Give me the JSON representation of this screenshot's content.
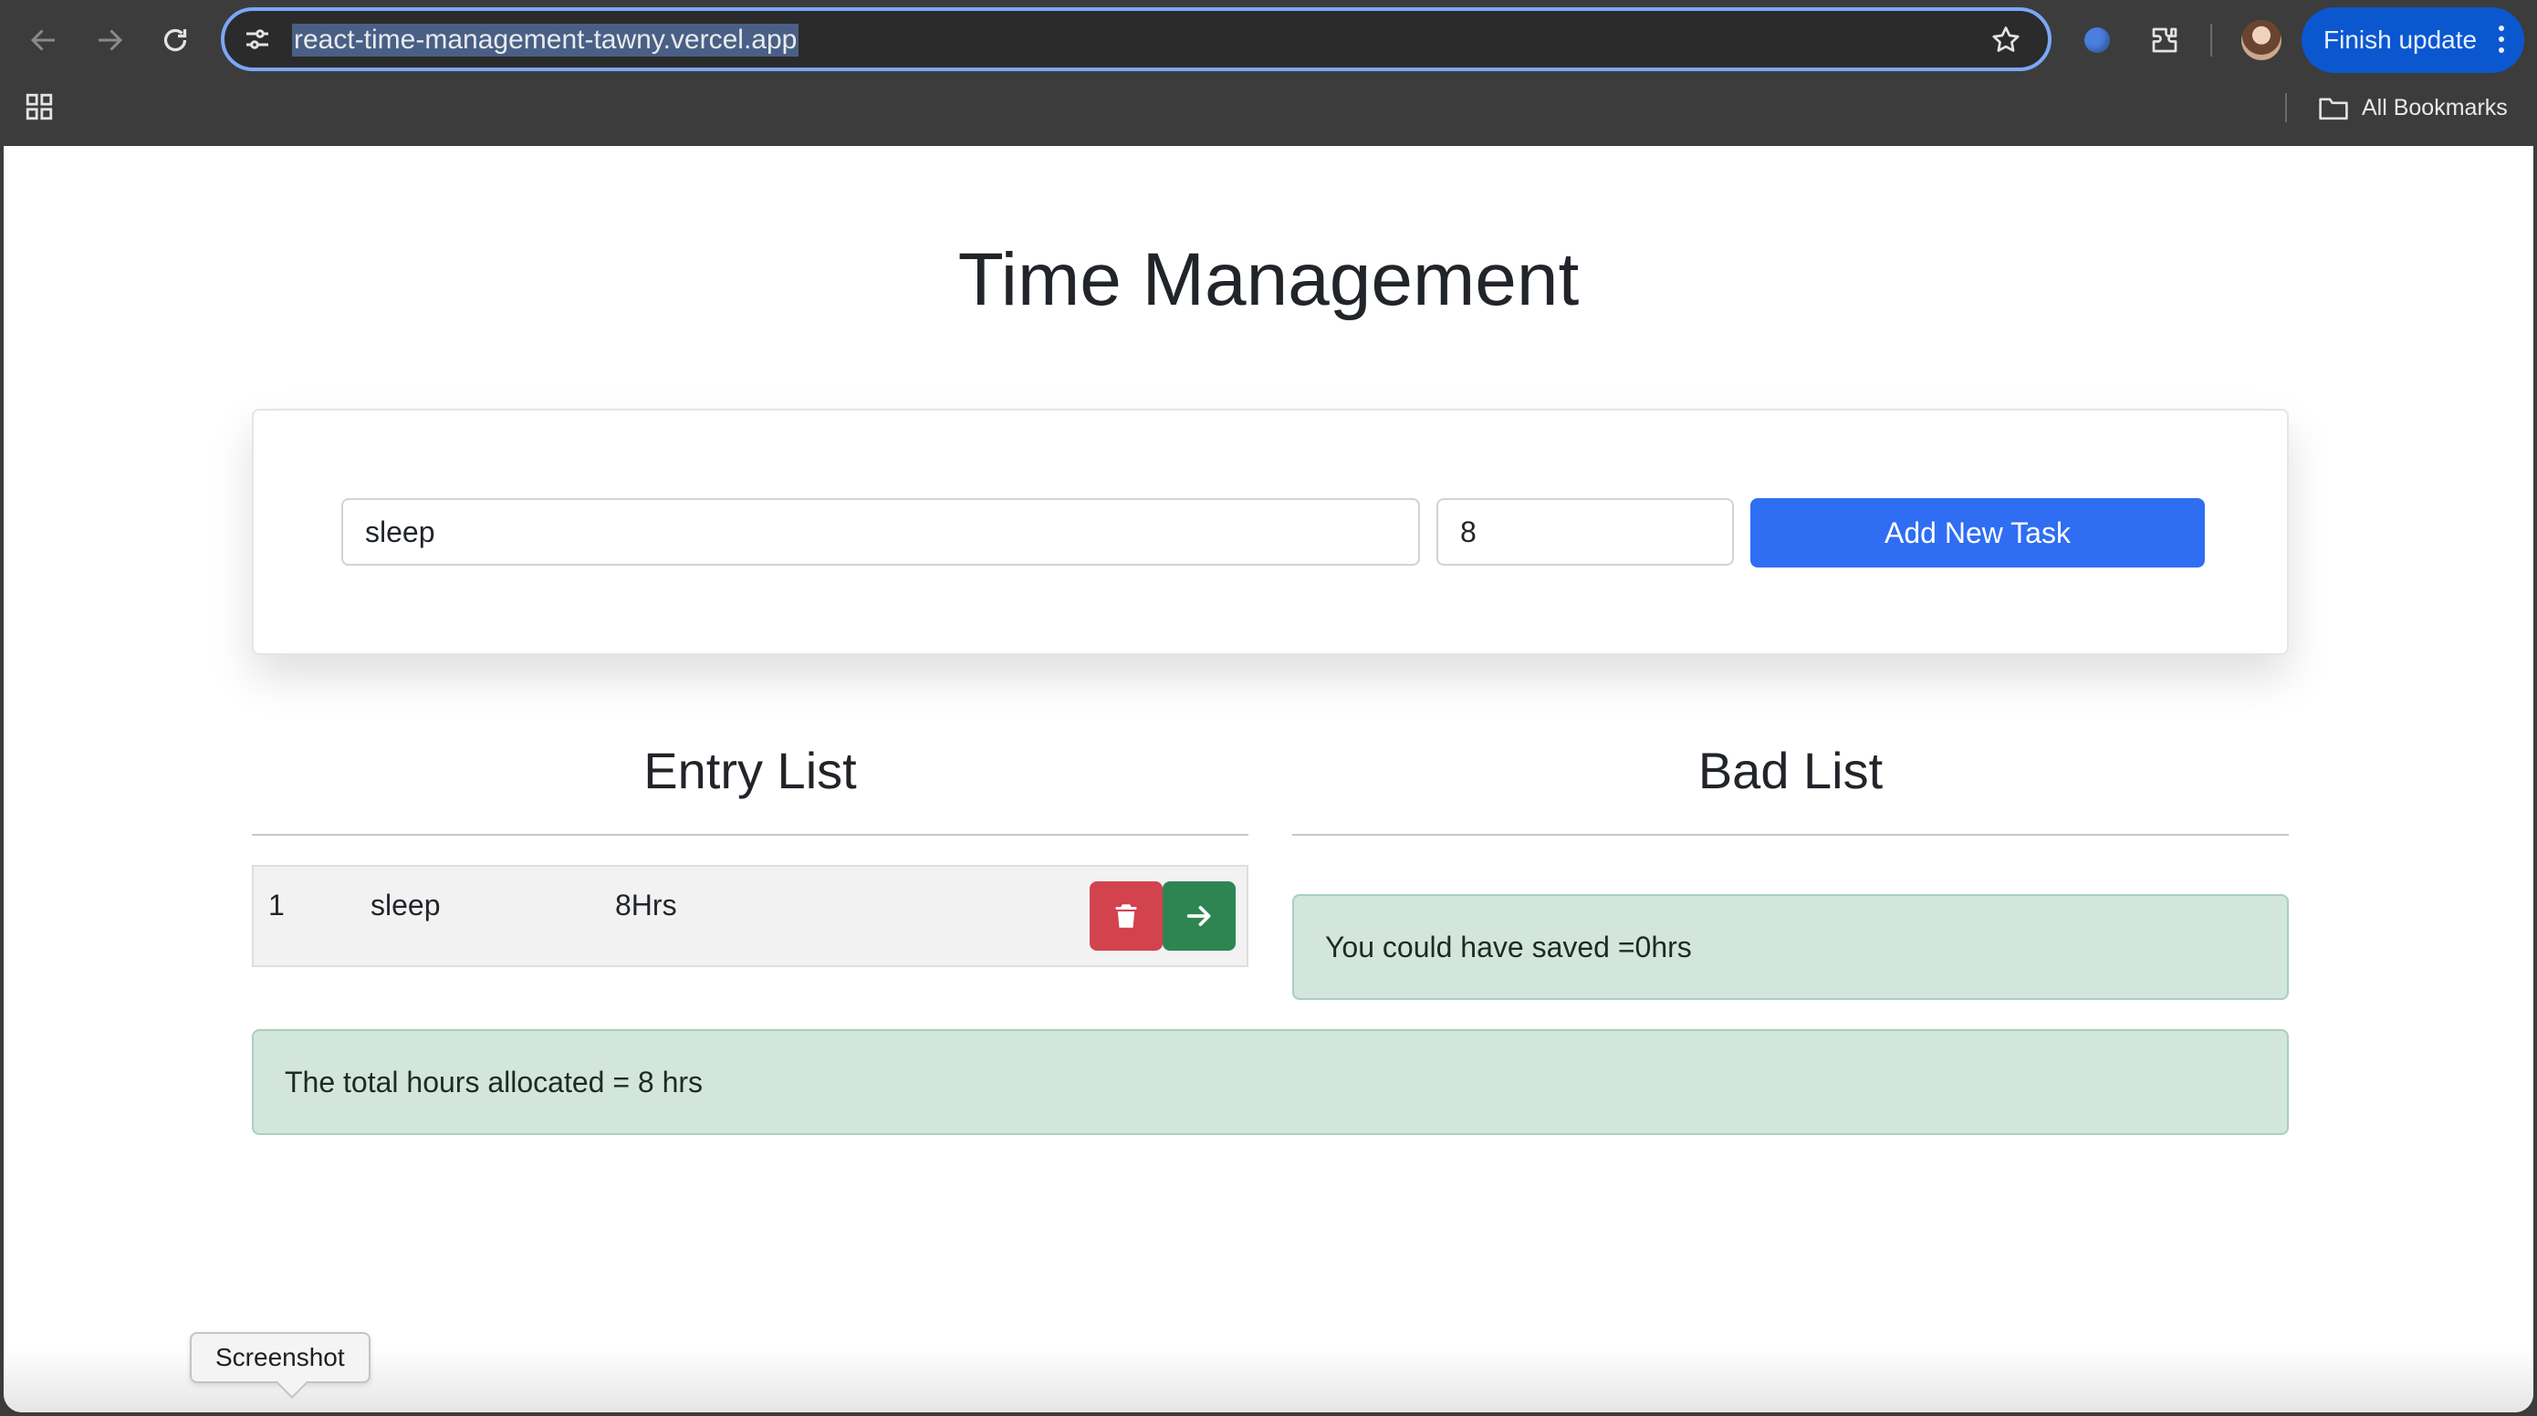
{
  "browser": {
    "url": "react-time-management-tawny.vercel.app",
    "update_button_label": "Finish update",
    "bookmarks_label": "All Bookmarks",
    "accent_color": "#0b57d0"
  },
  "page": {
    "title": "Time Management",
    "form": {
      "task_value": "sleep",
      "hours_value": "8",
      "add_button_label": "Add New Task",
      "add_button_color": "#2f6ef3"
    },
    "entry_list": {
      "heading": "Entry List",
      "rows": [
        {
          "index": "1",
          "task": "sleep",
          "hours": "8Hrs"
        }
      ],
      "delete_color": "#d2434e",
      "move_color": "#2f8551"
    },
    "bad_list": {
      "heading": "Bad List",
      "saved_message": "You could have saved =0hrs"
    },
    "total_message": "The total hours allocated = 8 hrs",
    "alert_color": "#d3e6dd"
  },
  "overlay": {
    "tooltip_label": "Screenshot"
  },
  "icons": [
    "back-arrow-icon",
    "forward-arrow-icon",
    "reload-icon",
    "site-info-icon",
    "star-icon",
    "extensions-icon",
    "apps-grid-icon",
    "folder-icon",
    "trash-icon",
    "arrow-right-icon"
  ]
}
